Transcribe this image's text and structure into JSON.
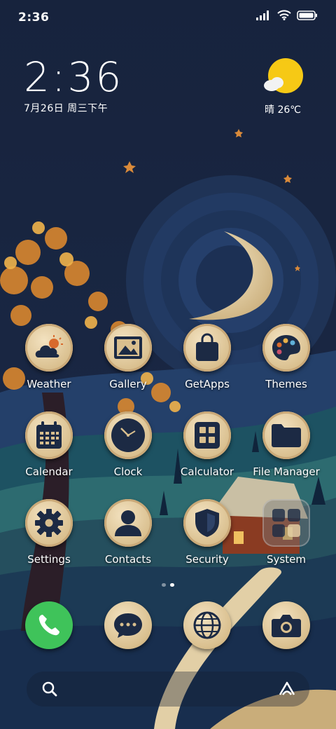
{
  "status_bar": {
    "time": "2:36",
    "icons": [
      "signal-icon",
      "wifi-icon",
      "battery-icon"
    ]
  },
  "clock_widget": {
    "time": "2:36",
    "date": "7月26日 周三下午"
  },
  "weather_widget": {
    "condition_icon": "sun-cloud-icon",
    "text": "晴 26℃"
  },
  "apps": [
    {
      "label": "Weather",
      "icon": "weather-icon"
    },
    {
      "label": "Gallery",
      "icon": "gallery-icon"
    },
    {
      "label": "GetApps",
      "icon": "getapps-bag-icon"
    },
    {
      "label": "Themes",
      "icon": "palette-icon"
    },
    {
      "label": "Calendar",
      "icon": "calendar-icon"
    },
    {
      "label": "Clock",
      "icon": "clock-icon"
    },
    {
      "label": "Calculator",
      "icon": "calculator-icon"
    },
    {
      "label": "File Manager",
      "icon": "folder-icon"
    },
    {
      "label": "Settings",
      "icon": "gear-icon"
    },
    {
      "label": "Contacts",
      "icon": "person-icon"
    },
    {
      "label": "Security",
      "icon": "shield-icon"
    },
    {
      "label": "System",
      "icon": "system-folder-icon"
    }
  ],
  "dock": [
    {
      "icon": "phone-icon"
    },
    {
      "icon": "messages-icon"
    },
    {
      "icon": "browser-globe-icon"
    },
    {
      "icon": "camera-icon"
    }
  ],
  "pager": {
    "pages": 2,
    "active": 1
  },
  "search_bar": {
    "left_icon": "search-icon",
    "right_icon": "assistant-icon"
  },
  "colors": {
    "icon_face": "#e6d2a8",
    "icon_glyph": "#1c2a44",
    "phone_green": "#3fc35a",
    "accent_sun": "#f6c915"
  }
}
